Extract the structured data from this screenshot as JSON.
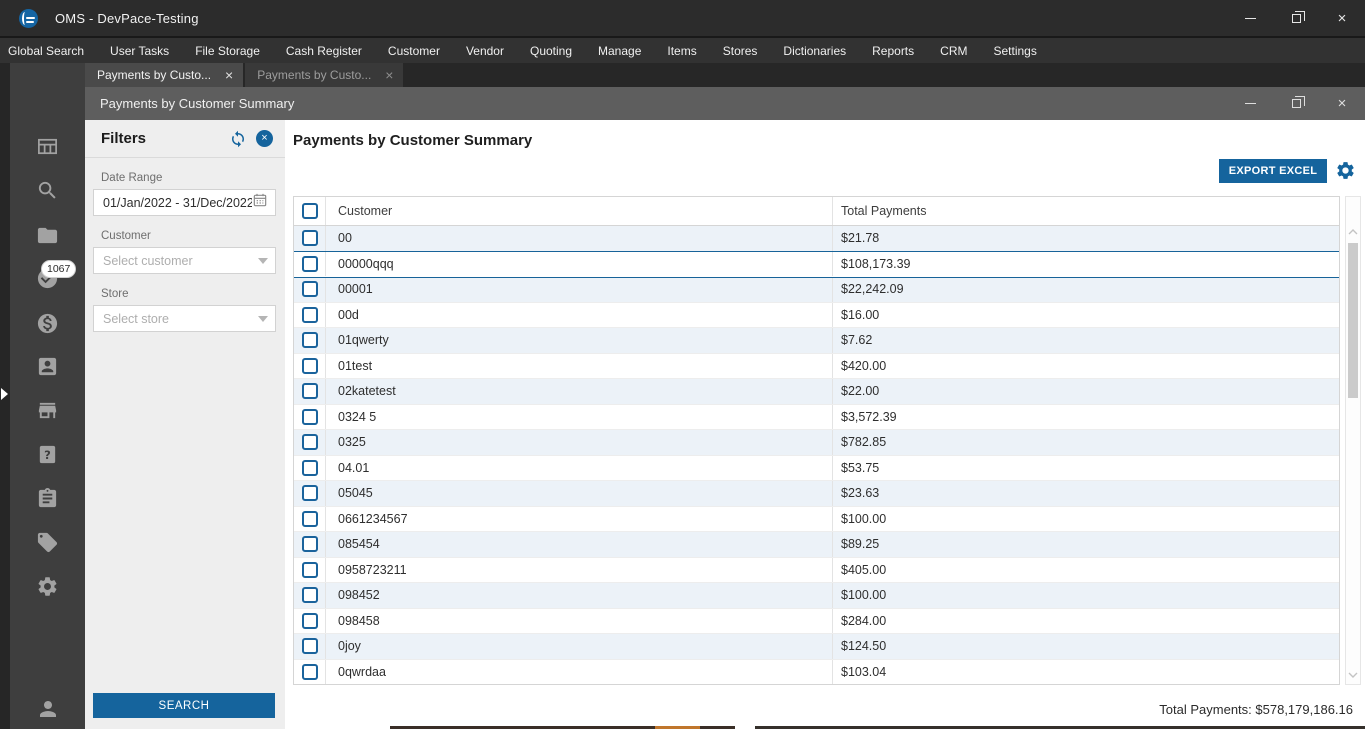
{
  "window": {
    "title": "OMS - DevPace-Testing"
  },
  "menubar": {
    "items": [
      "Global Search",
      "User Tasks",
      "File Storage",
      "Cash Register",
      "Customer",
      "Vendor",
      "Quoting",
      "Manage",
      "Items",
      "Stores",
      "Dictionaries",
      "Reports",
      "CRM",
      "Settings"
    ]
  },
  "tabs": [
    {
      "label": "Payments by Custo...",
      "active": true
    },
    {
      "label": "Payments by Custo...",
      "active": false
    }
  ],
  "inner_window": {
    "title": "Payments by Customer Summary"
  },
  "sidebar": {
    "badge_count": "1067",
    "icons": [
      "dashboard",
      "search",
      "documents",
      "approvals",
      "payments",
      "customers",
      "stores",
      "support",
      "orders",
      "tags",
      "settings"
    ],
    "footer_icon": "user"
  },
  "filters": {
    "title": "Filters",
    "date_range": {
      "label": "Date Range",
      "value": "01/Jan/2022 - 31/Dec/2022"
    },
    "customer": {
      "label": "Customer",
      "placeholder": "Select customer"
    },
    "store": {
      "label": "Store",
      "placeholder": "Select store"
    },
    "search_button": "SEARCH"
  },
  "report": {
    "title": "Payments by Customer Summary",
    "export_button": "EXPORT EXCEL",
    "total_summary": "Total Payments: $578,179,186.16"
  },
  "table": {
    "columns": [
      "Customer",
      "Total Payments"
    ],
    "selected_row_index": 1,
    "rows": [
      {
        "customer": "00",
        "total": "$21.78"
      },
      {
        "customer": "00000qqq",
        "total": "$108,173.39"
      },
      {
        "customer": "00001",
        "total": "$22,242.09"
      },
      {
        "customer": "00d",
        "total": "$16.00"
      },
      {
        "customer": "01qwerty",
        "total": "$7.62"
      },
      {
        "customer": "01test",
        "total": "$420.00"
      },
      {
        "customer": "02katetest",
        "total": "$22.00"
      },
      {
        "customer": "0324 5",
        "total": "$3,572.39"
      },
      {
        "customer": "0325",
        "total": "$782.85"
      },
      {
        "customer": "04.01",
        "total": "$53.75"
      },
      {
        "customer": "05045",
        "total": "$23.63"
      },
      {
        "customer": "0661234567",
        "total": "$100.00"
      },
      {
        "customer": "085454",
        "total": "$89.25"
      },
      {
        "customer": "0958723211",
        "total": "$405.00"
      },
      {
        "customer": "098452",
        "total": "$100.00"
      },
      {
        "customer": "098458",
        "total": "$284.00"
      },
      {
        "customer": "0joy",
        "total": "$124.50"
      },
      {
        "customer": "0qwrdaa",
        "total": "$103.04"
      }
    ]
  },
  "colors": {
    "accent": "#15649d",
    "row_alt": "#ecf2f8",
    "selected_border": "#176399"
  }
}
